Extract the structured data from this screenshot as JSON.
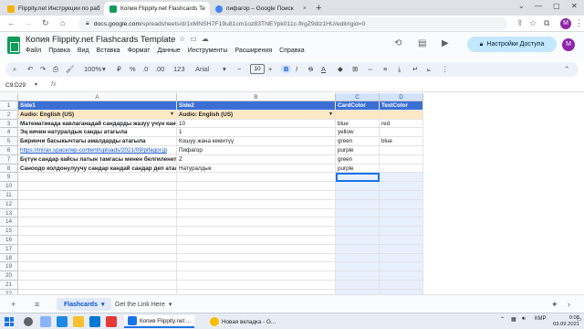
{
  "browser": {
    "tabs": [
      {
        "title": "Flippity.net Инструкции по раб",
        "favicon_color": "#f4b400"
      },
      {
        "title": "Копия Flippity.net Flashcards Te",
        "favicon_color": "#0f9d58"
      },
      {
        "title": "пифагор – Google Поиск",
        "favicon_color": "#4285f4"
      }
    ],
    "new_tab": "+",
    "url_host": "docs.google.com",
    "url_rest": "/spreadsheets/d/1xMNSH7F19u81cm1oz83TNEYpk011c-flrgZ9dlz1HU/edit#gid=0",
    "profile_initial": "M"
  },
  "sheets": {
    "title": "Копия Flippity.net Flashcards Template",
    "menu": [
      "Файл",
      "Правка",
      "Вид",
      "Вставка",
      "Формат",
      "Данные",
      "Инструменты",
      "Расширения",
      "Справка"
    ],
    "share_label": "Настройки Доступа",
    "toolbar": {
      "zoom": "100%",
      "currency": "₽",
      "percent": "%",
      "dec_less": ".0",
      "dec_more": ".00",
      "number_format": "123",
      "font": "Arial",
      "font_size": "10",
      "bold": "B",
      "italic": "I",
      "strike": "S",
      "text_color": "A"
    },
    "name_box": "C9:D29",
    "fx": "fx",
    "columns": [
      "A",
      "B",
      "C",
      "D"
    ],
    "rows": [
      [
        "Side1",
        "Side2",
        "CardColor",
        "TextColor"
      ],
      [
        "Audio: English (US)",
        "Audio: English (US)",
        "",
        ""
      ],
      [
        "Математикада кавлаганадай сандарды жазуу үчүн канча",
        "10",
        "blue",
        "red"
      ],
      [
        "Эң кичин натуралдык санды атагыла",
        "1",
        "yellow",
        ""
      ],
      [
        "Биринчи басыкычтагы амалдарды атагыла",
        "Кошуу жана кемитүү",
        "green",
        "blue"
      ],
      [
        "https://mirax.space/wp-content/uploads/2021/09/pifagor.jp",
        "Пифагор",
        "purple",
        ""
      ],
      [
        "Бүтүн сандар кайсы латын тамгасы менен белгиленет",
        "Z",
        "green",
        ""
      ],
      [
        "Саноодо колдонулуучу сандар кандай сандар деп атал",
        "Натуралдык",
        "purple",
        ""
      ],
      [
        "",
        "",
        "",
        ""
      ],
      [
        "",
        "",
        "",
        ""
      ],
      [
        "",
        "",
        "",
        ""
      ],
      [
        "",
        "",
        "",
        ""
      ],
      [
        "",
        "",
        "",
        ""
      ],
      [
        "",
        "",
        "",
        ""
      ],
      [
        "",
        "",
        "",
        ""
      ],
      [
        "",
        "",
        "",
        ""
      ],
      [
        "",
        "",
        "",
        ""
      ],
      [
        "",
        "",
        "",
        ""
      ],
      [
        "",
        "",
        "",
        ""
      ],
      [
        "",
        "",
        "",
        ""
      ],
      [
        "",
        "",
        "",
        ""
      ],
      [
        "",
        "",
        "",
        ""
      ],
      [
        "",
        "",
        "",
        ""
      ],
      [
        "",
        "",
        "",
        ""
      ]
    ],
    "row_numbers": [
      "1",
      "2",
      "3",
      "4",
      "5",
      "6",
      "7",
      "8",
      "9",
      "10",
      "11",
      "12",
      "13",
      "14",
      "15",
      "16",
      "17",
      "18",
      "19",
      "20",
      "21",
      "22",
      "23",
      "24"
    ],
    "sheet_tabs": [
      {
        "label": "Flashcards",
        "active": true
      },
      {
        "label": "Get the Link Here",
        "active": false
      }
    ],
    "add_sheet": "+",
    "all_sheets": "≡"
  },
  "taskbar": {
    "apps": [
      {
        "label": "Копия Flippity.net ...",
        "active": true
      },
      {
        "label": "Новая вкладка - G...",
        "active": false
      }
    ],
    "lang": "КМР",
    "time": "0:08",
    "date": "03.09.2021"
  },
  "colors": {
    "header_fill": "#3c6fd6",
    "subheader_fill": "#fce8c4",
    "selection": "#1a73e8",
    "share_button": "#c2e7ff"
  }
}
